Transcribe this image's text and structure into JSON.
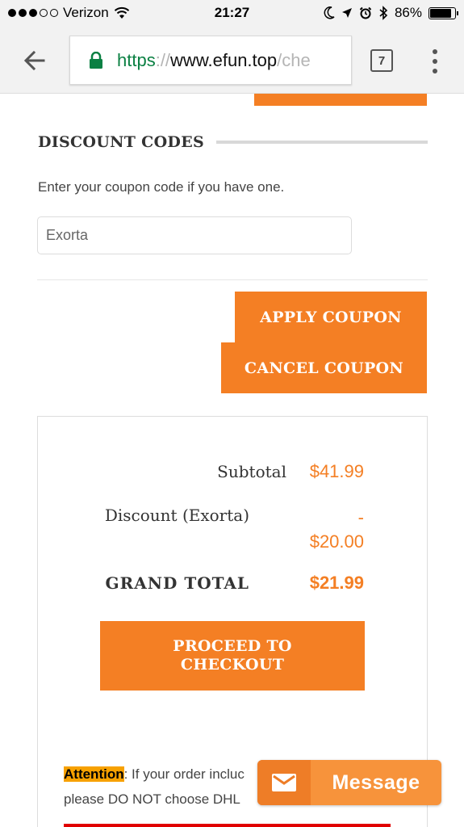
{
  "status_bar": {
    "carrier": "Verizon",
    "time": "21:27",
    "battery": "86%",
    "battery_level": 0.86
  },
  "browser": {
    "url_scheme": "https",
    "url_separator": "://",
    "url_host": "www.efun.top",
    "url_path": "/che",
    "tab_count": "7"
  },
  "discount": {
    "title": "DISCOUNT CODES",
    "help_text": "Enter your coupon code if you have one.",
    "coupon_value": "Exorta",
    "apply_label": "APPLY COUPON",
    "cancel_label": "CANCEL COUPON"
  },
  "totals": {
    "subtotal_label": "Subtotal",
    "subtotal_value": "$41.99",
    "discount_label": "Discount (Exorta)",
    "discount_value_sign": "-",
    "discount_value": "$20.00",
    "grand_total_label": "GRAND TOTAL",
    "grand_total_value": "$21.99",
    "checkout_label": "PROCEED TO CHECKOUT"
  },
  "notice": {
    "tag": "Attention",
    "text_line1": ": If your order incluc",
    "text_line2": "please DO NOT choose DHL"
  },
  "message_widget": {
    "label": "Message"
  },
  "colors": {
    "accent": "#f47f24",
    "secure_green": "#0b8043",
    "attention_highlight": "#f7a100",
    "warning_red": "#e00000"
  }
}
